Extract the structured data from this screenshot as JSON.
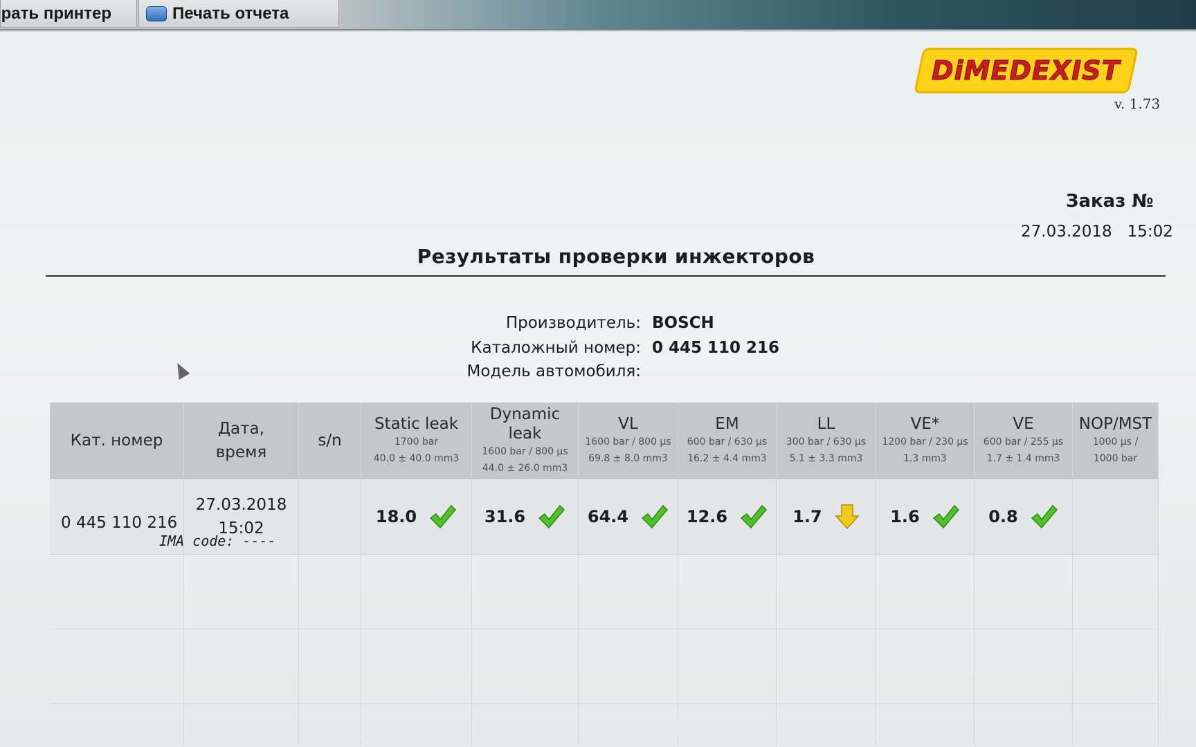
{
  "toolbar": {
    "select_printer": "рать принтер",
    "print_report": "Печать отчета"
  },
  "logo": {
    "text": "DiMEDEXIST"
  },
  "version": "v. 1.73",
  "order": {
    "label": "Заказ №",
    "date": "27.03.2018",
    "time": "15:02"
  },
  "report_title": "Результаты проверки инжекторов",
  "info": {
    "manufacturer_label": "Производитель:",
    "manufacturer_value": "BOSCH",
    "catalog_label": "Каталожный номер:",
    "catalog_value": "0 445 110 216",
    "car_model_label": "Модель автомобиля:",
    "car_model_value": ""
  },
  "table": {
    "headers": [
      {
        "name": "Кат. номер",
        "sub1": "",
        "sub2": ""
      },
      {
        "name": "Дата,",
        "name2": "время",
        "sub1": "",
        "sub2": ""
      },
      {
        "name": "s/n",
        "sub1": "",
        "sub2": ""
      },
      {
        "name": "Static leak",
        "sub1": "1700 bar",
        "sub2": "40.0 ± 40.0 mm3"
      },
      {
        "name": "Dynamic leak",
        "sub1": "1600 bar / 800 µs",
        "sub2": "44.0 ± 26.0 mm3"
      },
      {
        "name": "VL",
        "sub1": "1600 bar / 800 µs",
        "sub2": "69.8 ± 8.0 mm3"
      },
      {
        "name": "EM",
        "sub1": "600 bar / 630 µs",
        "sub2": "16.2 ± 4.4 mm3"
      },
      {
        "name": "LL",
        "sub1": "300 bar / 630 µs",
        "sub2": "5.1 ± 3.3 mm3"
      },
      {
        "name": "VE*",
        "sub1": "1200 bar / 230 µs",
        "sub2": "1.3 mm3"
      },
      {
        "name": "VE",
        "sub1": "600 bar / 255 µs",
        "sub2": "1.7 ± 1.4 mm3"
      },
      {
        "name": "NOP/MST",
        "sub1": "1000 µs /",
        "sub2": "1000 bar"
      }
    ],
    "row": {
      "cat": "0 445 110 216",
      "date": "27.03.2018",
      "time": "15:02",
      "ima": "IMA code:  ----",
      "sn": "",
      "results": [
        {
          "value": "18.0",
          "status": "ok"
        },
        {
          "value": "31.6",
          "status": "ok"
        },
        {
          "value": "64.4",
          "status": "ok"
        },
        {
          "value": "12.6",
          "status": "ok"
        },
        {
          "value": "1.7",
          "status": "low"
        },
        {
          "value": "1.6",
          "status": "ok"
        },
        {
          "value": "0.8",
          "status": "ok"
        }
      ],
      "nop": ""
    }
  },
  "colors": {
    "ok": "#4fc12b",
    "low": "#f2c81a",
    "header_bg": "#c5c8ca"
  }
}
